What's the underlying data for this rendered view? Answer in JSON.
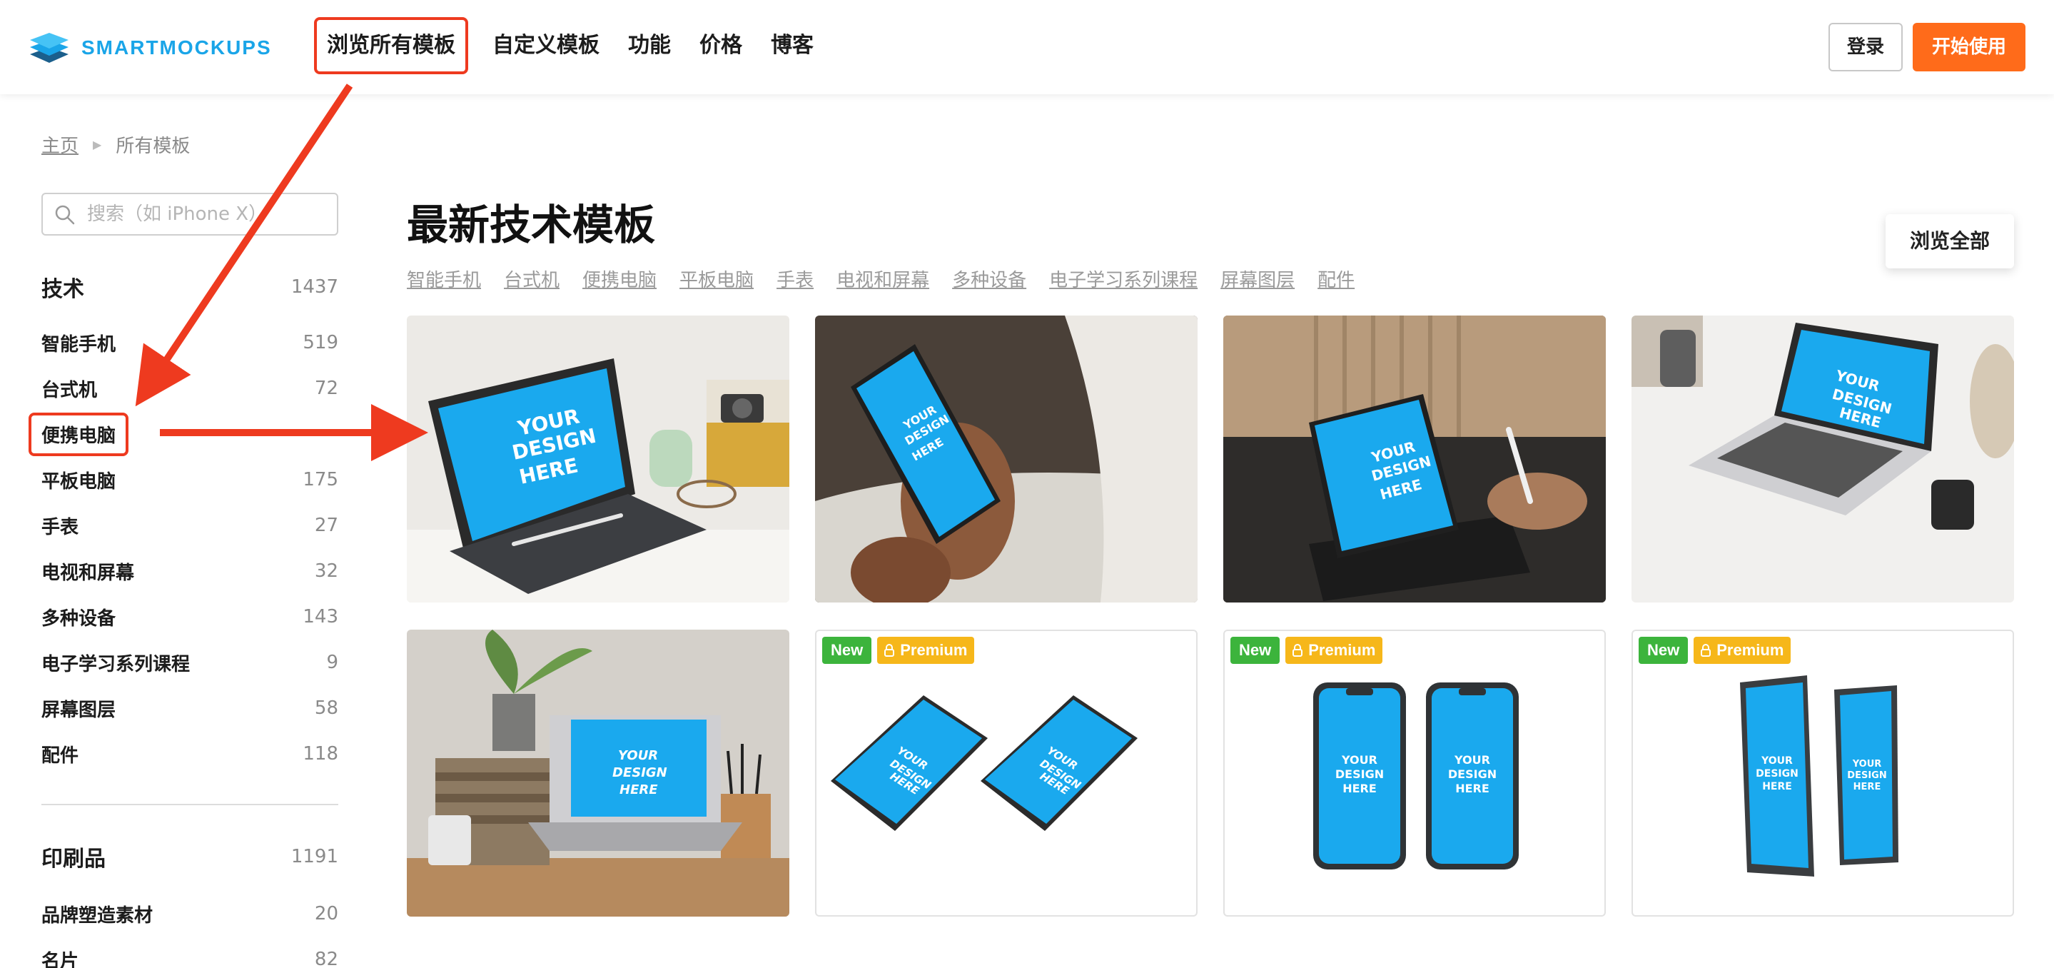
{
  "brand": {
    "name": "SMARTMOCKUPS"
  },
  "nav": {
    "items": [
      "浏览所有模板",
      "自定义模板",
      "功能",
      "价格",
      "博客"
    ],
    "login": "登录",
    "start": "开始使用"
  },
  "breadcrumb": {
    "home": "主页",
    "current": "所有模板"
  },
  "search": {
    "placeholder": "搜索（如 iPhone X）"
  },
  "sidebar": {
    "tech": {
      "name": "技术",
      "count": "1437"
    },
    "tech_items": [
      {
        "name": "智能手机",
        "count": "519"
      },
      {
        "name": "台式机",
        "count": "72"
      },
      {
        "name": "便携电脑",
        "count": ""
      },
      {
        "name": "平板电脑",
        "count": "175"
      },
      {
        "name": "手表",
        "count": "27"
      },
      {
        "name": "电视和屏幕",
        "count": "32"
      },
      {
        "name": "多种设备",
        "count": "143"
      },
      {
        "name": "电子学习系列课程",
        "count": "9"
      },
      {
        "name": "屏幕图层",
        "count": "58"
      },
      {
        "name": "配件",
        "count": "118"
      }
    ],
    "print": {
      "name": "印刷品",
      "count": "1191"
    },
    "print_items": [
      {
        "name": "品牌塑造素材",
        "count": "20"
      },
      {
        "name": "名片",
        "count": "82"
      }
    ]
  },
  "main": {
    "title": "最新技术模板",
    "browse_all": "浏览全部",
    "subtabs": [
      "智能手机",
      "台式机",
      "便携电脑",
      "平板电脑",
      "手表",
      "电视和屏幕",
      "多种设备",
      "电子学习系列课程",
      "屏幕图层",
      "配件"
    ]
  },
  "cards": {
    "screen_text": [
      "YOUR",
      "DESIGN",
      "HERE"
    ],
    "badge_new": "New",
    "badge_premium": "Premium"
  },
  "colors": {
    "accent": "#ff6b1a",
    "brand": "#1aa5e8",
    "screen": "#1aa9ee",
    "highlight": "#ee3a1f",
    "badge_new": "#3cb43c",
    "badge_premium": "#f6b71a"
  }
}
